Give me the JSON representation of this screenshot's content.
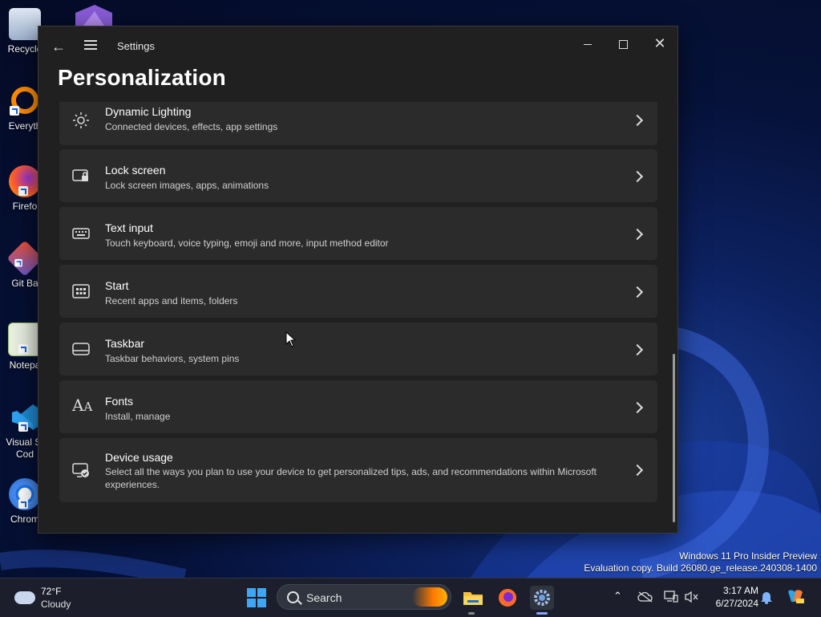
{
  "desktop": {
    "icons": [
      {
        "label": "Recycle"
      },
      {
        "label": "Everyth"
      },
      {
        "label": "Firefo"
      },
      {
        "label": "Git Ba"
      },
      {
        "label": "Notepa"
      },
      {
        "label": "Visual St\nCod"
      },
      {
        "label": "Chrom"
      }
    ],
    "watermark_line1": "Windows 11 Pro Insider Preview",
    "watermark_line2": "Evaluation copy. Build 26080.ge_release.240308-1400"
  },
  "window": {
    "title": "Settings",
    "page_title": "Personalization",
    "items": [
      {
        "title": "Dynamic Lighting",
        "subtitle": "Connected devices, effects, app settings",
        "icon": "dynamic-lighting-icon"
      },
      {
        "title": "Lock screen",
        "subtitle": "Lock screen images, apps, animations",
        "icon": "lock-screen-icon"
      },
      {
        "title": "Text input",
        "subtitle": "Touch keyboard, voice typing, emoji and more, input method editor",
        "icon": "keyboard-icon"
      },
      {
        "title": "Start",
        "subtitle": "Recent apps and items, folders",
        "icon": "start-icon"
      },
      {
        "title": "Taskbar",
        "subtitle": "Taskbar behaviors, system pins",
        "icon": "taskbar-icon"
      },
      {
        "title": "Fonts",
        "subtitle": "Install, manage",
        "icon": "fonts-icon"
      },
      {
        "title": "Device usage",
        "subtitle": "Select all the ways you plan to use your device to get personalized tips, ads, and recommendations within Microsoft experiences.",
        "icon": "device-usage-icon"
      }
    ]
  },
  "taskbar": {
    "weather_temp": "72°F",
    "weather_condition": "Cloudy",
    "search_placeholder": "Search",
    "time": "3:17 AM",
    "date": "6/27/2024"
  },
  "colors": {
    "window_bg": "#202020",
    "card_bg": "#2b2b2b",
    "taskbar_bg": "#1c1f2b",
    "accent": "#3da7f5"
  }
}
